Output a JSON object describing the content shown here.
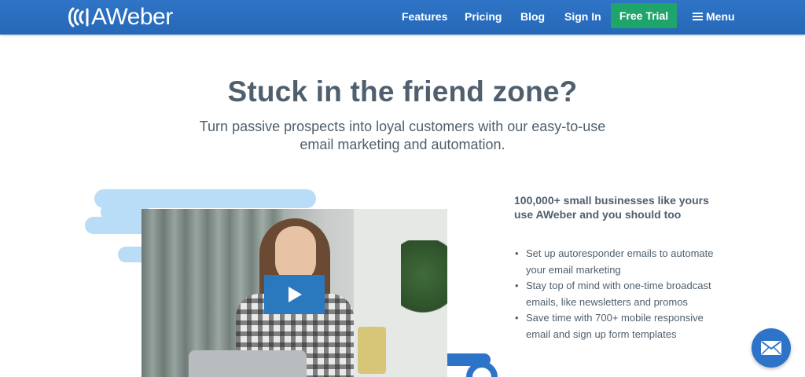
{
  "header": {
    "logo_text": "AWeber",
    "nav": {
      "features": "Features",
      "pricing": "Pricing",
      "blog": "Blog",
      "sign_in": "Sign In",
      "free_trial": "Free Trial",
      "menu": "Menu"
    }
  },
  "hero": {
    "title": "Stuck in the friend zone?",
    "subtitle": "Turn passive prospects into loyal customers with our easy-to-use email marketing and automation."
  },
  "benefits": {
    "heading": "100,000+ small businesses like yours use AWeber and you should too",
    "items": [
      "Set up autoresponder emails to automate your email marketing",
      "Stay top of mind with one-time broadcast emails, like newsletters and promos",
      "Save time with 700+ mobile responsive email and sign up form templates"
    ]
  },
  "icons": {
    "logo": "aweber-logo-icon",
    "menu": "hamburger-icon",
    "play": "play-icon",
    "chat": "envelope-icon"
  },
  "colors": {
    "header_blue": "#2b6dc0",
    "cta_green": "#1fa46c",
    "text_slate": "#4f5f6e",
    "cloud_light_blue": "#b9dcf7",
    "accent_blue": "#2d73c8"
  }
}
